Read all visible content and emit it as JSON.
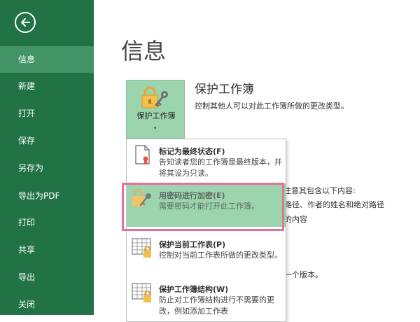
{
  "sidebar": {
    "back_icon": "arrow-left-icon",
    "items": [
      {
        "label": "信息",
        "active": true
      },
      {
        "label": "新建"
      },
      {
        "label": "打开"
      },
      {
        "label": "保存"
      },
      {
        "label": "另存为"
      },
      {
        "label": "导出为PDF"
      },
      {
        "label": "打印"
      },
      {
        "label": "共享"
      },
      {
        "label": "导出"
      },
      {
        "label": "关闭"
      }
    ]
  },
  "main": {
    "title": "信息",
    "protect": {
      "button_label": "保护工作簿",
      "button_caret": "▾",
      "icon": "lock-key-icon",
      "title": "保护工作簿",
      "description": "控制其他人可以对此工作簿所做的更改类型。"
    },
    "background_lines": [
      "前注意其包含以下内容:",
      "路径、作者的姓名和绝对路径",
      "的内容",
      "一个版本。"
    ]
  },
  "dropdown": {
    "items": [
      {
        "title": "标记为最终状态(F)",
        "description": "告知读者您的工作簿是最终版本，并将其设为只读。",
        "icon": "document-ribbon-icon"
      },
      {
        "title": "用密码进行加密(E)",
        "description": "需要密码才能打开此工作簿。",
        "icon": "lock-key-icon",
        "highlighted": true
      },
      {
        "title": "保护当前工作表(P)",
        "description": "控制对当前工作表所做的更改类型。",
        "icon": "sheet-lock-icon"
      },
      {
        "title": "保护工作簿结构(W)",
        "description": "防止对工作簿结构进行不需要的更改，例如添加工作表",
        "icon": "sheet-lock-icon"
      }
    ]
  },
  "colors": {
    "sidebar": "#217346",
    "sidebar_active": "#439467",
    "highlight": "#9bd4ad",
    "focus_outline": "#e86f9a"
  }
}
